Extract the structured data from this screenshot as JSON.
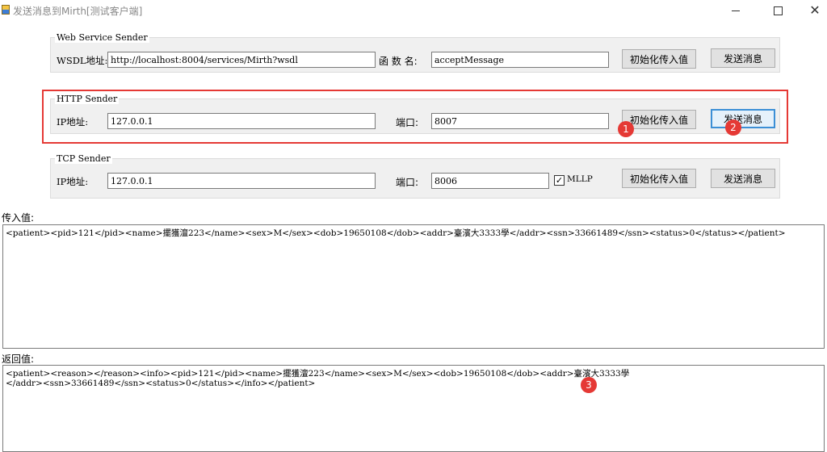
{
  "window": {
    "title": "发送消息到Mirth[测试客户端]",
    "min_icon": "minimize-icon",
    "max_icon": "maximize-icon",
    "close_icon": "close-icon",
    "close_glyph": "✕"
  },
  "web_service": {
    "group_title": "Web  Service Sender",
    "wsdl_label": "WSDL地址:",
    "wsdl_value": "http://localhost:8004/services/Mirth?wsdl",
    "func_label": "函 数 名:",
    "func_value": "acceptMessage",
    "init_button": "初始化传入值",
    "send_button": "发送消息"
  },
  "http": {
    "group_title": "HTTP Sender",
    "ip_label": "IP地址:",
    "ip_value": "127.0.0.1",
    "port_label": "端口:",
    "port_value": "8007",
    "init_button": "初始化传入值",
    "send_button": "发送消息",
    "highlight_color": "#e53935"
  },
  "tcp": {
    "group_title": "TCP Sender",
    "ip_label": "IP地址:",
    "ip_value": "127.0.0.1",
    "port_label": "端口:",
    "port_value": "8006",
    "mllp_label": "MLLP",
    "mllp_checked": true,
    "check_glyph": "✓",
    "init_button": "初始化传入值",
    "send_button": "发送消息"
  },
  "input_section": {
    "label": "传入值:",
    "lines": [
      "<patient><pid>121</pid><name>擺獲澶223</name><sex>M</sex><dob>19650108</dob><addr>臺濱大3333學</addr><ssn>33661489</ssn><status>0</status></patient>"
    ]
  },
  "output_section": {
    "label": "返回值:",
    "lines": [
      "<patient><reason></reason><info><pid>121</pid><name>擺獲澶223</name><sex>M</sex><dob>19650108</dob><addr>臺濱大3333學",
      "</addr><ssn>33661489</ssn><status>0</status></info></patient>"
    ]
  },
  "markers": [
    "1",
    "2",
    "3"
  ]
}
